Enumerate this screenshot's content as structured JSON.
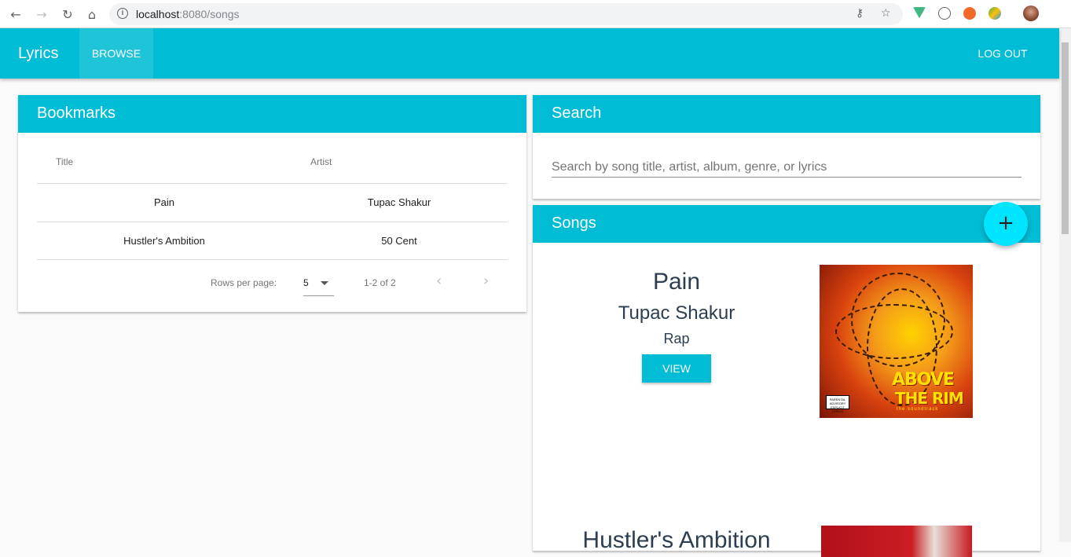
{
  "browser": {
    "url_host": "localhost",
    "url_rest": ":8080/songs"
  },
  "toolbar": {
    "brand": "Lyrics",
    "browse_label": "BROWSE",
    "logout_label": "LOG OUT"
  },
  "bookmarks": {
    "title": "Bookmarks",
    "headers": {
      "title": "Title",
      "artist": "Artist"
    },
    "rows": [
      {
        "title": "Pain",
        "artist": "Tupac Shakur"
      },
      {
        "title": "Hustler's Ambition",
        "artist": "50 Cent"
      }
    ],
    "pagination": {
      "rows_per_page_label": "Rows per page:",
      "rows_per_page": "5",
      "range": "1-2 of 2"
    }
  },
  "search": {
    "title": "Search",
    "placeholder": "Search by song title, artist, album, genre, or lyrics"
  },
  "songs": {
    "title": "Songs",
    "add_label": "+",
    "items": [
      {
        "title": "Pain",
        "artist": "Tupac Shakur",
        "genre": "Rap",
        "view_label": "VIEW",
        "album_text_1": "ABOVE",
        "album_text_2": "THE RIM",
        "album_text_3": "the soundtrack"
      },
      {
        "title": "Hustler's Ambition"
      }
    ]
  }
}
